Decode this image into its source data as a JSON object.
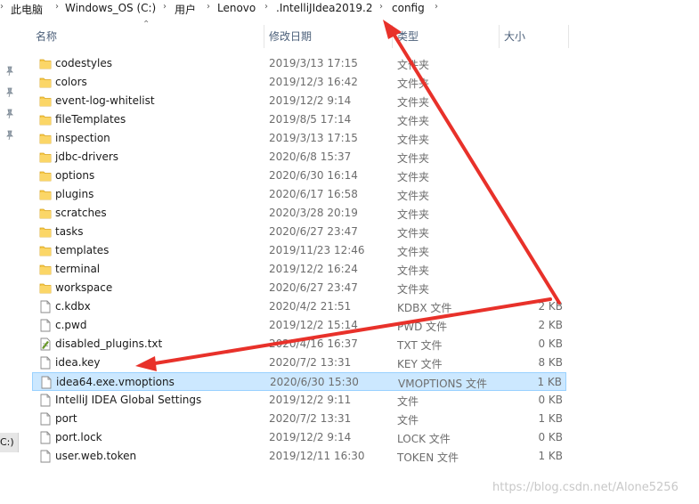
{
  "breadcrumb": [
    "此电脑",
    "Windows_OS (C:)",
    "用户",
    "Lenovo",
    ".IntelliJIdea2019.2",
    "config"
  ],
  "navigation": {
    "drive_label": "C:)"
  },
  "columns": {
    "name": "名称",
    "modified": "修改日期",
    "type": "类型",
    "size": "大小"
  },
  "files": [
    {
      "name": "codestyles",
      "modified": "2019/3/13 17:15",
      "type": "文件夹",
      "size": "",
      "icon": "folder-icon"
    },
    {
      "name": "colors",
      "modified": "2019/12/3 16:42",
      "type": "文件夹",
      "size": "",
      "icon": "folder-icon"
    },
    {
      "name": "event-log-whitelist",
      "modified": "2019/12/2 9:14",
      "type": "文件夹",
      "size": "",
      "icon": "folder-icon"
    },
    {
      "name": "fileTemplates",
      "modified": "2019/8/5 17:14",
      "type": "文件夹",
      "size": "",
      "icon": "folder-icon"
    },
    {
      "name": "inspection",
      "modified": "2019/3/13 17:15",
      "type": "文件夹",
      "size": "",
      "icon": "folder-icon"
    },
    {
      "name": "jdbc-drivers",
      "modified": "2020/6/8 15:37",
      "type": "文件夹",
      "size": "",
      "icon": "folder-icon"
    },
    {
      "name": "options",
      "modified": "2020/6/30 16:14",
      "type": "文件夹",
      "size": "",
      "icon": "folder-icon"
    },
    {
      "name": "plugins",
      "modified": "2020/6/17 16:58",
      "type": "文件夹",
      "size": "",
      "icon": "folder-icon"
    },
    {
      "name": "scratches",
      "modified": "2020/3/28 20:19",
      "type": "文件夹",
      "size": "",
      "icon": "folder-icon"
    },
    {
      "name": "tasks",
      "modified": "2020/6/27 23:47",
      "type": "文件夹",
      "size": "",
      "icon": "folder-icon"
    },
    {
      "name": "templates",
      "modified": "2019/11/23 12:46",
      "type": "文件夹",
      "size": "",
      "icon": "folder-icon"
    },
    {
      "name": "terminal",
      "modified": "2019/12/2 16:24",
      "type": "文件夹",
      "size": "",
      "icon": "folder-icon"
    },
    {
      "name": "workspace",
      "modified": "2020/6/27 23:47",
      "type": "文件夹",
      "size": "",
      "icon": "folder-icon"
    },
    {
      "name": "c.kdbx",
      "modified": "2020/4/2 21:51",
      "type": "KDBX 文件",
      "size": "2 KB",
      "icon": "file-icon"
    },
    {
      "name": "c.pwd",
      "modified": "2019/12/2 15:14",
      "type": "PWD 文件",
      "size": "2 KB",
      "icon": "file-icon"
    },
    {
      "name": "disabled_plugins.txt",
      "modified": "2020/4/16 16:37",
      "type": "TXT 文件",
      "size": "0 KB",
      "icon": "text-file-icon"
    },
    {
      "name": "idea.key",
      "modified": "2020/7/2 13:31",
      "type": "KEY 文件",
      "size": "8 KB",
      "icon": "file-icon"
    },
    {
      "name": "idea64.exe.vmoptions",
      "modified": "2020/6/30 15:30",
      "type": "VMOPTIONS 文件",
      "size": "1 KB",
      "icon": "file-icon",
      "selected": true
    },
    {
      "name": "IntelliJ IDEA Global Settings",
      "modified": "2019/12/2 9:11",
      "type": "文件",
      "size": "0 KB",
      "icon": "file-icon"
    },
    {
      "name": "port",
      "modified": "2020/7/2 13:31",
      "type": "文件",
      "size": "1 KB",
      "icon": "file-icon"
    },
    {
      "name": "port.lock",
      "modified": "2019/12/2 9:14",
      "type": "LOCK 文件",
      "size": "0 KB",
      "icon": "file-icon"
    },
    {
      "name": "user.web.token",
      "modified": "2019/12/11 16:30",
      "type": "TOKEN 文件",
      "size": "1 KB",
      "icon": "file-icon"
    }
  ],
  "watermark": "https://blog.csdn.net/Alone5256",
  "colors": {
    "selection_bg": "#cce8ff",
    "selection_border": "#99d1ff",
    "folder": "#f7c948",
    "annotation_arrow": "#e8312a"
  }
}
